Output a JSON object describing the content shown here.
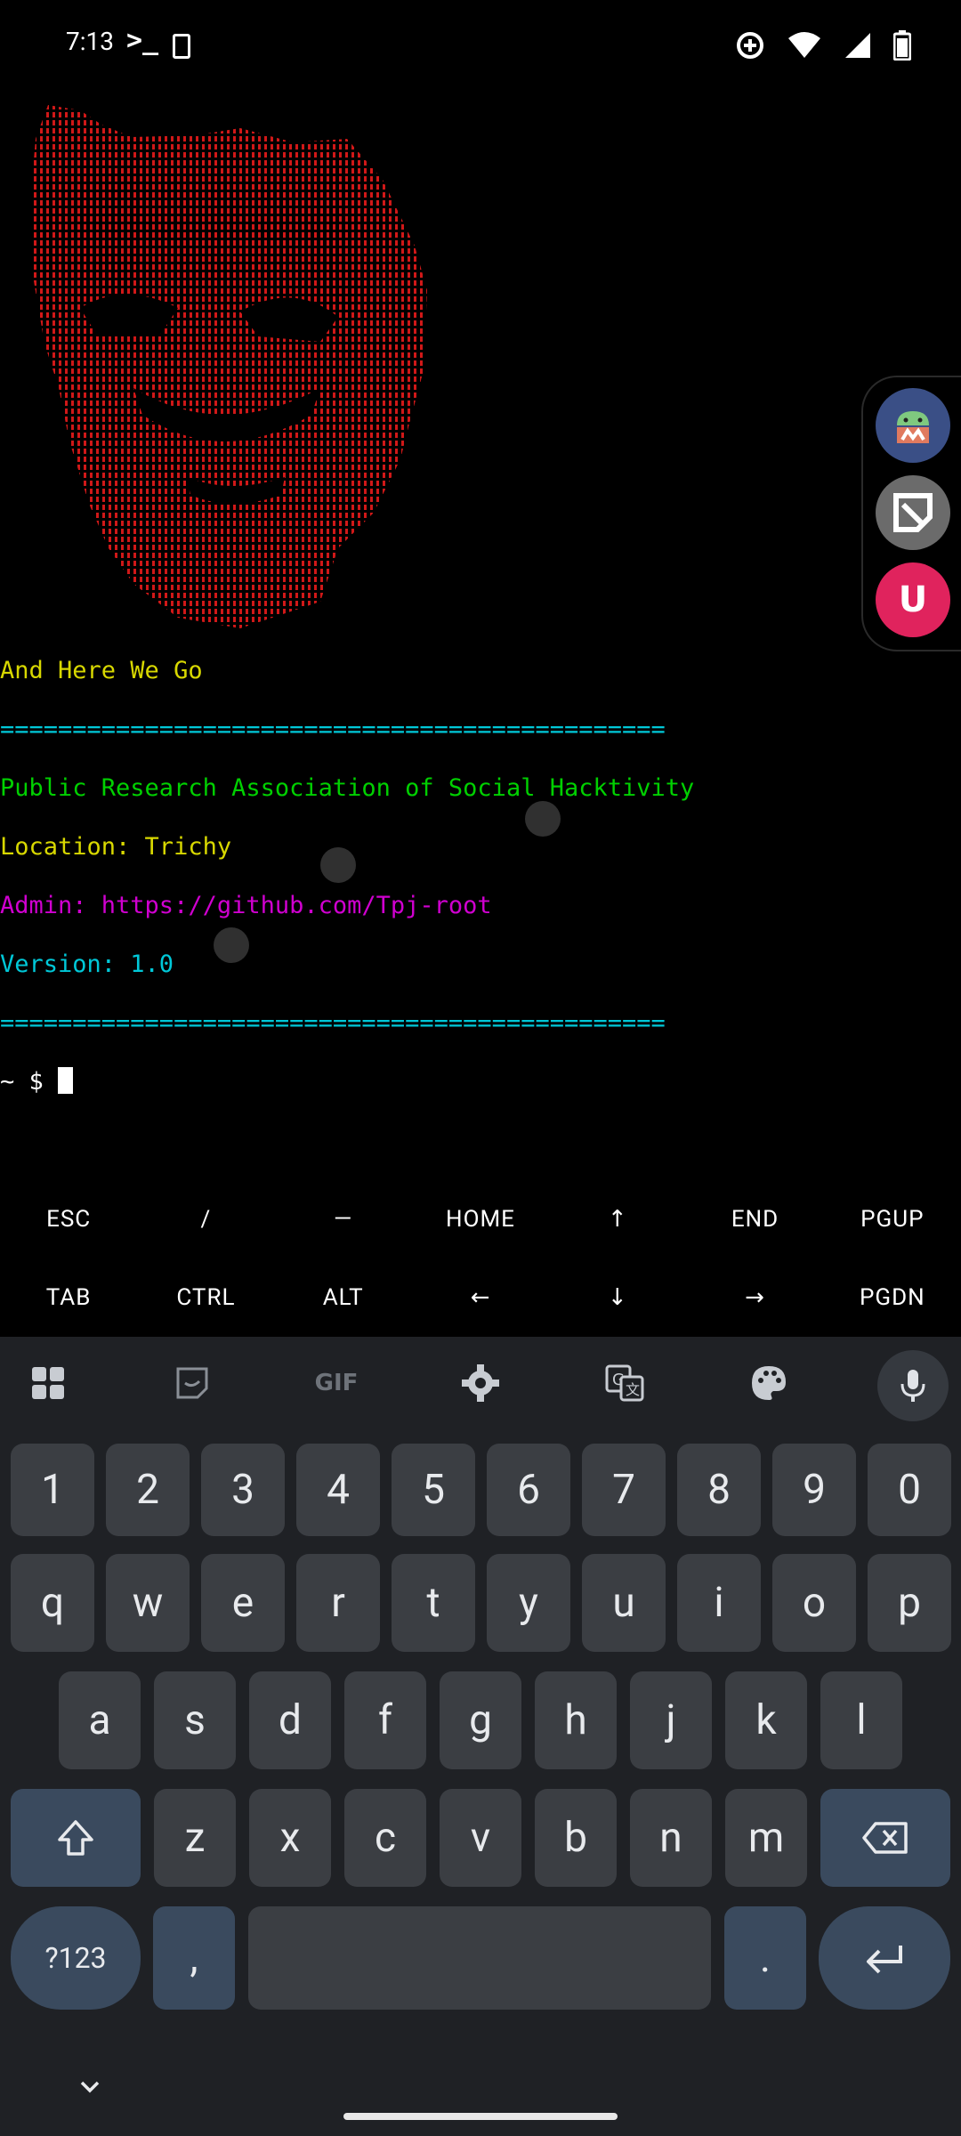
{
  "status_bar": {
    "time": "7:13",
    "prompt_glyph": ">_",
    "icons": [
      "termux-sim-icon",
      "data-saver-icon",
      "wifi-icon",
      "signal-icon",
      "battery-icon"
    ]
  },
  "terminal": {
    "lines": [
      {
        "text": "And Here We Go",
        "color": "#d8d800"
      },
      {
        "text": "==============================================",
        "color": "#00c8d8"
      },
      {
        "text": "Public Research Association of Social Hacktivity",
        "color": "#00d000"
      },
      {
        "text": "Location: Trichy",
        "color": "#d8d800"
      },
      {
        "text": "Admin: https://github.com/Tpj-root",
        "color": "#d000d0"
      },
      {
        "text": "Version: 1.0",
        "color": "#00c8d8"
      },
      {
        "text": "==============================================",
        "color": "#00c8d8"
      }
    ],
    "prompt": "~ $ ",
    "art_color": "#d01818"
  },
  "floating_bubbles": [
    {
      "name": "android-tools-app",
      "icon": "android-icon"
    },
    {
      "name": "notes-app",
      "icon": "note-icon"
    },
    {
      "name": "uc-app",
      "icon": "uc-icon",
      "label": "U"
    }
  ],
  "extra_keys": {
    "row1": [
      "ESC",
      "/",
      "—",
      "HOME",
      "↑",
      "END",
      "PGUP"
    ],
    "row2": [
      "TAB",
      "CTRL",
      "ALT",
      "←",
      "↓",
      "→",
      "PGDN"
    ]
  },
  "keyboard": {
    "toolbar_gif": "GIF",
    "numbers": [
      "1",
      "2",
      "3",
      "4",
      "5",
      "6",
      "7",
      "8",
      "9",
      "0"
    ],
    "row_q": [
      "q",
      "w",
      "e",
      "r",
      "t",
      "y",
      "u",
      "i",
      "o",
      "p"
    ],
    "row_a": [
      "a",
      "s",
      "d",
      "f",
      "g",
      "h",
      "j",
      "k",
      "l"
    ],
    "row_z": [
      "z",
      "x",
      "c",
      "v",
      "b",
      "n",
      "m"
    ],
    "symbols_key": "?123",
    "comma": ",",
    "period": "."
  }
}
